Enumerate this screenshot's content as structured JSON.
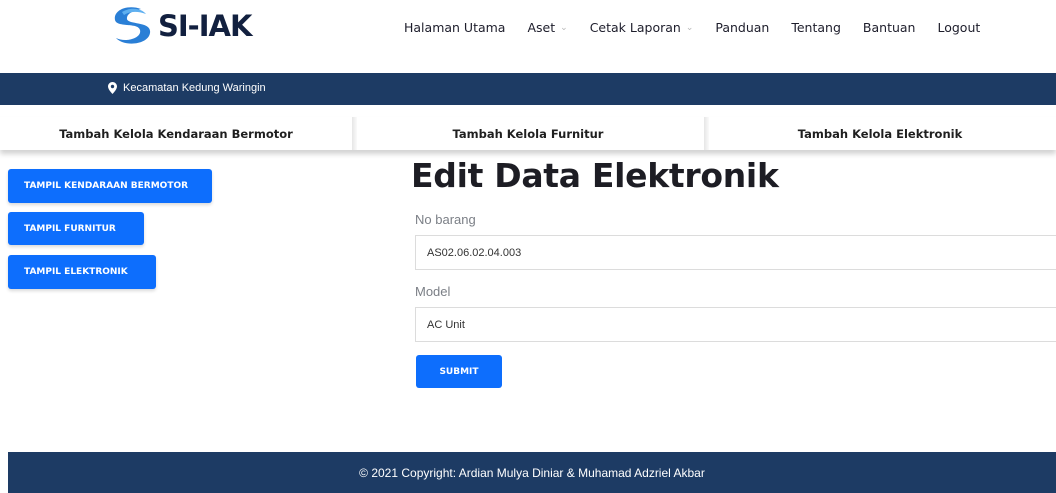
{
  "brand": {
    "logo_text": "SI-IAK",
    "logo_color": "#12203f",
    "swirl_color": "#2a7fd6"
  },
  "nav": {
    "items": [
      {
        "label": "Halaman Utama",
        "dropdown": false
      },
      {
        "label": "Aset",
        "dropdown": true
      },
      {
        "label": "Cetak Laporan",
        "dropdown": true
      },
      {
        "label": "Panduan",
        "dropdown": false
      },
      {
        "label": "Tentang",
        "dropdown": false
      },
      {
        "label": "Bantuan",
        "dropdown": false
      },
      {
        "label": "Logout",
        "dropdown": false
      }
    ]
  },
  "location": {
    "icon": "map-marker-icon",
    "text": "Kecamatan Kedung Waringin"
  },
  "tabs": [
    {
      "label": "Tambah Kelola Kendaraan Bermotor"
    },
    {
      "label": "Tambah Kelola Furnitur"
    },
    {
      "label": "Tambah Kelola Elektronik"
    }
  ],
  "sidebar": {
    "buttons": [
      {
        "label": "TAMPIL KENDARAAN BERMOTOR"
      },
      {
        "label": "TAMPIL FURNITUR"
      },
      {
        "label": "TAMPIL ELEKTRONIK"
      }
    ]
  },
  "form": {
    "title": "Edit Data Elektronik",
    "fields": [
      {
        "label": "No barang",
        "value": "AS02.06.02.04.003"
      },
      {
        "label": "Model",
        "value": "AC Unit"
      }
    ],
    "submit_label": "SUBMIT"
  },
  "footer": {
    "text": "© 2021 Copyright: Ardian Mulya Diniar & Muhamad Adzriel Akbar"
  },
  "colors": {
    "primary": "#0d6efd",
    "navy": "#1d3b64"
  }
}
